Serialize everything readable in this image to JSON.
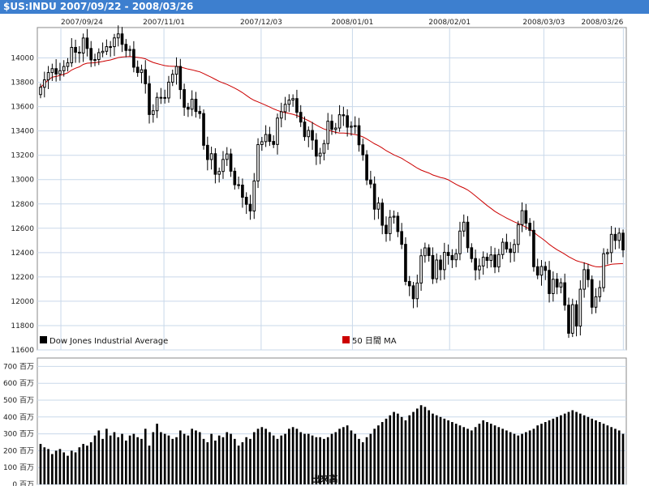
{
  "title": "$US:INDU 2007/09/22 - 2008/03/26",
  "chart_data": [
    {
      "type": "candlestick",
      "x_ticks": [
        "2007/09/24",
        "2007/11/01",
        "2007/12/03",
        "2008/01/01",
        "2008/02/01",
        "2008/03/03",
        "2008/03/26"
      ],
      "y_ticks": [
        11600,
        11800,
        12000,
        12200,
        12400,
        12600,
        12800,
        13000,
        13200,
        13400,
        13600,
        13800,
        14000
      ],
      "ylim": [
        11600,
        14250
      ],
      "grid": true,
      "legend": [
        {
          "name": "Dow Jones Industrial Average",
          "color": "#000000"
        },
        {
          "name": "50 日間 MA",
          "color": "#cc0000"
        }
      ],
      "close": [
        13759,
        13820,
        13880,
        13912,
        13868,
        13895,
        13930,
        13960,
        14087,
        14047,
        14040,
        14164,
        14078,
        13984,
        13987,
        14044,
        14055,
        14093,
        14093,
        14165,
        14198,
        14112,
        14062,
        14070,
        13924,
        13880,
        13903,
        13788,
        13535,
        13566,
        13676,
        13675,
        13671,
        13801,
        13866,
        13930,
        13740,
        13595,
        13579,
        13661,
        13560,
        13543,
        13282,
        13165,
        13213,
        13044,
        13067,
        13166,
        13211,
        13069,
        12958,
        12955,
        12855,
        12797,
        12742,
        12989,
        13288,
        13312,
        13371,
        13314,
        13289,
        13506,
        13558,
        13619,
        13654,
        13666,
        13553,
        13473,
        13353,
        13404,
        13325,
        13193,
        13217,
        13296,
        13480,
        13413,
        13424,
        13533,
        13525,
        13431,
        13439,
        13443,
        13286,
        13204,
        12997,
        12964,
        12757,
        12807,
        12625,
        12556,
        12691,
        12699,
        12573,
        12468,
        12163,
        12127,
        12021,
        12150,
        12374,
        12439,
        12376,
        12185,
        12339,
        12260,
        12402,
        12376,
        12341,
        12391,
        12577,
        12650,
        12440,
        12351,
        12258,
        12290,
        12362,
        12336,
        12381,
        12282,
        12384,
        12485,
        12430,
        12401,
        12467,
        12630,
        12745,
        12642,
        12583,
        12284,
        12215,
        12286,
        12254,
        12063,
        12181,
        12117,
        12152,
        11968,
        11737,
        11972,
        11796,
        12099,
        12260,
        12178,
        11951,
        12037,
        12112,
        12391,
        12400,
        12550,
        12500,
        12560,
        12422
      ],
      "volume_label": "出来高",
      "volume_unit": "百万",
      "volume_ticks": [
        0,
        100,
        200,
        300,
        400,
        500,
        600,
        700
      ],
      "volume": [
        240,
        220,
        210,
        180,
        200,
        210,
        190,
        170,
        200,
        190,
        220,
        240,
        230,
        250,
        290,
        320,
        270,
        330,
        290,
        310,
        280,
        300,
        260,
        290,
        300,
        280,
        270,
        330,
        230,
        310,
        360,
        310,
        300,
        290,
        270,
        280,
        320,
        300,
        290,
        330,
        320,
        310,
        270,
        250,
        300,
        260,
        290,
        280,
        310,
        300,
        270,
        230,
        250,
        280,
        270,
        310,
        330,
        340,
        330,
        310,
        290,
        270,
        290,
        300,
        330,
        340,
        330,
        310,
        300,
        300,
        290,
        280,
        280,
        270,
        280,
        300,
        310,
        330,
        340,
        350,
        320,
        300,
        270,
        250,
        280,
        300,
        330,
        350,
        370,
        390,
        410,
        430,
        420,
        400,
        380,
        410,
        430,
        450,
        470,
        460,
        440,
        420,
        410,
        400,
        390,
        380,
        370,
        360,
        350,
        340,
        330,
        320,
        340,
        360,
        380,
        370,
        360,
        350,
        340,
        330,
        320,
        310,
        300,
        290,
        300,
        310,
        320,
        330,
        350,
        360,
        370,
        380,
        390,
        400,
        410,
        420,
        430,
        440,
        430,
        420,
        410,
        400,
        390,
        380,
        370,
        360,
        350,
        340,
        330,
        320,
        300
      ]
    }
  ]
}
